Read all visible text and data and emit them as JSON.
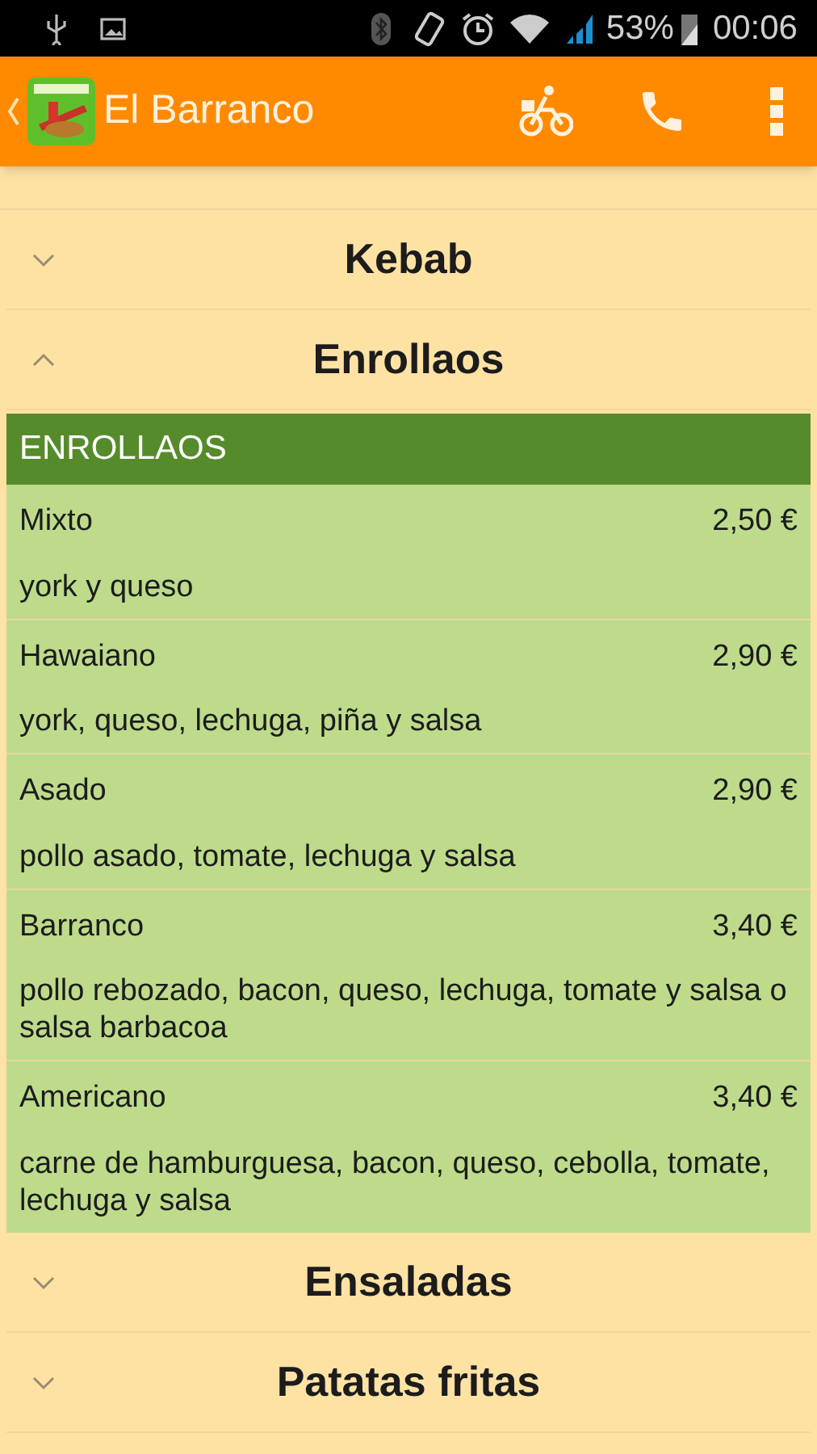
{
  "status_bar": {
    "battery": "53%",
    "time": "00:06"
  },
  "app_bar": {
    "title": "El Barranco"
  },
  "categories": [
    {
      "name": "Kebab",
      "expanded": false
    },
    {
      "name": "Enrollaos",
      "expanded": true,
      "header": "ENROLLAOS",
      "items": [
        {
          "name": "Mixto",
          "price": "2,50 €",
          "description": "york y queso"
        },
        {
          "name": "Hawaiano",
          "price": "2,90 €",
          "description": "york, queso, lechuga, piña y salsa"
        },
        {
          "name": "Asado",
          "price": "2,90 €",
          "description": "pollo asado, tomate, lechuga y salsa"
        },
        {
          "name": "Barranco",
          "price": "3,40 €",
          "description": "pollo rebozado, bacon, queso, lechuga, tomate y salsa o salsa barbacoa"
        },
        {
          "name": "Americano",
          "price": "3,40 €",
          "description": "carne de hamburguesa, bacon, queso, cebolla, tomate, lechuga y salsa"
        }
      ]
    },
    {
      "name": "Ensaladas",
      "expanded": false
    },
    {
      "name": "Patatas fritas",
      "expanded": false
    }
  ]
}
